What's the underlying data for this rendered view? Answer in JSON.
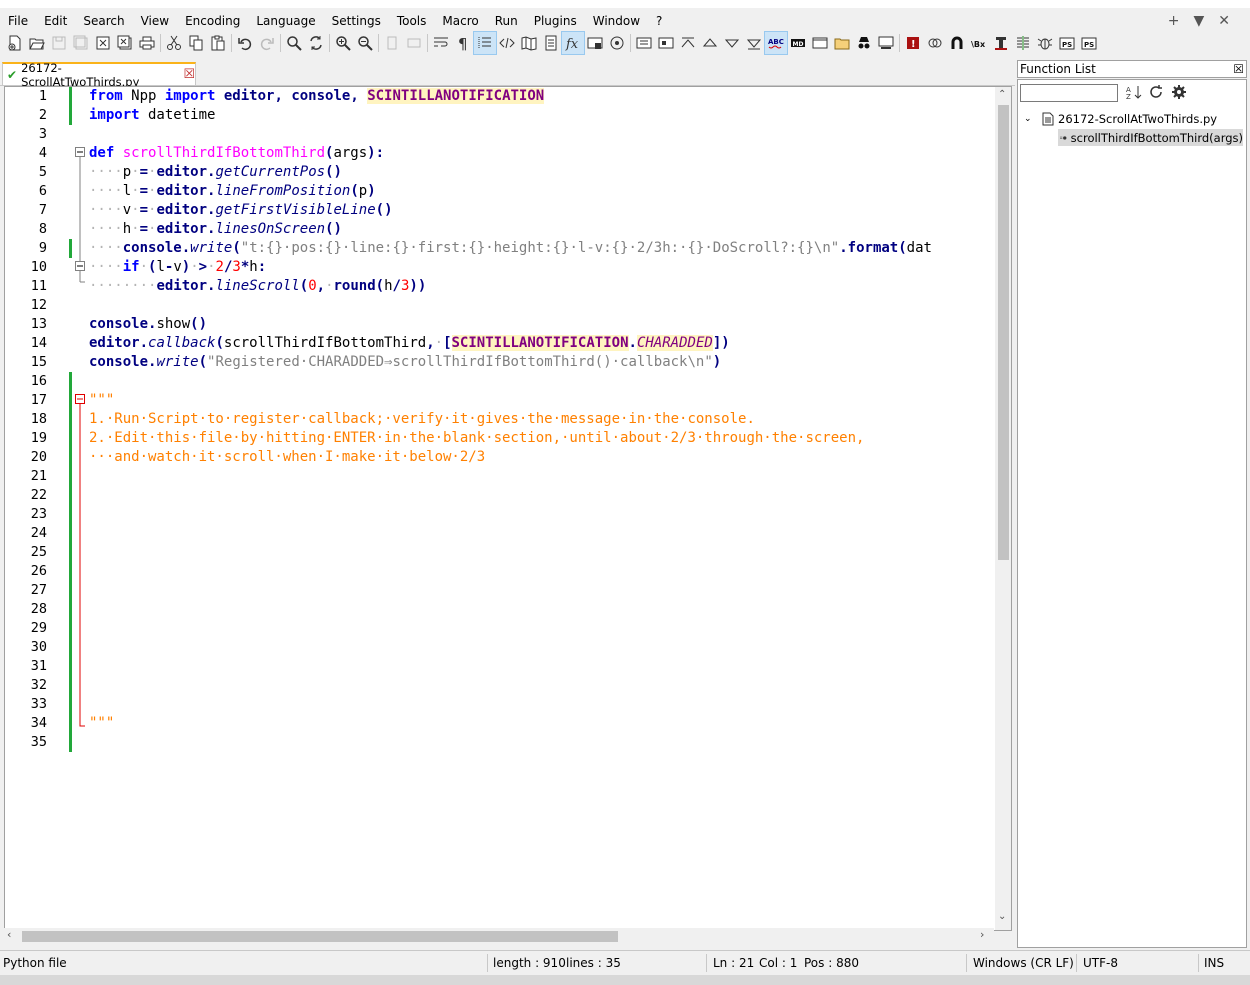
{
  "menubar": {
    "items": [
      "File",
      "Edit",
      "Search",
      "View",
      "Encoding",
      "Language",
      "Settings",
      "Tools",
      "Macro",
      "Run",
      "Plugins",
      "Window",
      "?"
    ],
    "right": [
      "+",
      "▼",
      "✕"
    ]
  },
  "tab": {
    "label": "26172-ScrollAtTwoThirds.py",
    "close": "☒",
    "check": "✔"
  },
  "editor": {
    "line_numbers": [
      "1",
      "2",
      "3",
      "4",
      "5",
      "6",
      "7",
      "8",
      "9",
      "10",
      "11",
      "12",
      "13",
      "14",
      "15",
      "16",
      "17",
      "18",
      "19",
      "20",
      "21",
      "22",
      "23",
      "24",
      "25",
      "26",
      "27",
      "28",
      "29",
      "30",
      "31",
      "32",
      "33",
      "34",
      "35"
    ],
    "code": [
      [
        {
          "t": "from",
          "c": "kw"
        },
        {
          "t": " Npp ",
          "c": ""
        },
        {
          "t": "import",
          "c": "kw"
        },
        {
          "t": " editor",
          "c": "cl2"
        },
        {
          "t": ", ",
          "c": "op"
        },
        {
          "t": "console",
          "c": "cl2"
        },
        {
          "t": ", ",
          "c": "op"
        },
        {
          "t": "SCINTILLANOTIFICATION",
          "c": "hl"
        }
      ],
      [
        {
          "t": "import",
          "c": "kw"
        },
        {
          "t": " datetime",
          "c": ""
        }
      ],
      [],
      [
        {
          "t": "def",
          "c": "kw"
        },
        {
          "t": " scrollThirdIfBottomThird",
          "c": "fn"
        },
        {
          "t": "(",
          "c": "op"
        },
        {
          "t": "args",
          "c": ""
        },
        {
          "t": "):",
          "c": "op"
        }
      ],
      [
        {
          "t": "····",
          "c": "ws"
        },
        {
          "t": "p",
          "c": ""
        },
        {
          "t": "·",
          "c": "ws"
        },
        {
          "t": "=",
          "c": "op"
        },
        {
          "t": "·",
          "c": "ws"
        },
        {
          "t": "editor",
          "c": "cl2"
        },
        {
          "t": ".",
          "c": "op"
        },
        {
          "t": "getCurrentPos",
          "c": "mth"
        },
        {
          "t": "()",
          "c": "op"
        }
      ],
      [
        {
          "t": "····",
          "c": "ws"
        },
        {
          "t": "l",
          "c": ""
        },
        {
          "t": "·",
          "c": "ws"
        },
        {
          "t": "=",
          "c": "op"
        },
        {
          "t": "·",
          "c": "ws"
        },
        {
          "t": "editor",
          "c": "cl2"
        },
        {
          "t": ".",
          "c": "op"
        },
        {
          "t": "lineFromPosition",
          "c": "mth"
        },
        {
          "t": "(",
          "c": "op"
        },
        {
          "t": "p",
          "c": ""
        },
        {
          "t": ")",
          "c": "op"
        }
      ],
      [
        {
          "t": "····",
          "c": "ws"
        },
        {
          "t": "v",
          "c": ""
        },
        {
          "t": "·",
          "c": "ws"
        },
        {
          "t": "=",
          "c": "op"
        },
        {
          "t": "·",
          "c": "ws"
        },
        {
          "t": "editor",
          "c": "cl2"
        },
        {
          "t": ".",
          "c": "op"
        },
        {
          "t": "getFirstVisibleLine",
          "c": "mth"
        },
        {
          "t": "()",
          "c": "op"
        }
      ],
      [
        {
          "t": "····",
          "c": "ws"
        },
        {
          "t": "h",
          "c": ""
        },
        {
          "t": "·",
          "c": "ws"
        },
        {
          "t": "=",
          "c": "op"
        },
        {
          "t": "·",
          "c": "ws"
        },
        {
          "t": "editor",
          "c": "cl2"
        },
        {
          "t": ".",
          "c": "op"
        },
        {
          "t": "linesOnScreen",
          "c": "mth"
        },
        {
          "t": "()",
          "c": "op"
        }
      ],
      [
        {
          "t": "····",
          "c": "ws"
        },
        {
          "t": "console",
          "c": "cl2"
        },
        {
          "t": ".",
          "c": "op"
        },
        {
          "t": "write",
          "c": "mth"
        },
        {
          "t": "(",
          "c": "op"
        },
        {
          "t": "\"t:{}·pos:{}·line:{}·first:{}·height:{}·l-v:{}·2/3h:·{}·DoScroll?:{}\\n\"",
          "c": "str"
        },
        {
          "t": ".",
          "c": "op"
        },
        {
          "t": "format",
          "c": "cl2"
        },
        {
          "t": "(",
          "c": "op"
        },
        {
          "t": "dat",
          "c": ""
        }
      ],
      [
        {
          "t": "····",
          "c": "ws"
        },
        {
          "t": "if",
          "c": "kw"
        },
        {
          "t": "·",
          "c": "ws"
        },
        {
          "t": "(",
          "c": "op"
        },
        {
          "t": "l",
          "c": ""
        },
        {
          "t": "-",
          "c": "op"
        },
        {
          "t": "v",
          "c": ""
        },
        {
          "t": ")",
          "c": "op"
        },
        {
          "t": "·",
          "c": "ws"
        },
        {
          "t": ">",
          "c": "op"
        },
        {
          "t": "·",
          "c": "ws"
        },
        {
          "t": "2",
          "c": "num"
        },
        {
          "t": "/",
          "c": "op"
        },
        {
          "t": "3",
          "c": "num"
        },
        {
          "t": "*",
          "c": "op"
        },
        {
          "t": "h",
          "c": ""
        },
        {
          "t": ":",
          "c": "op"
        }
      ],
      [
        {
          "t": "········",
          "c": "ws"
        },
        {
          "t": "editor",
          "c": "cl2"
        },
        {
          "t": ".",
          "c": "op"
        },
        {
          "t": "lineScroll",
          "c": "mth"
        },
        {
          "t": "(",
          "c": "op"
        },
        {
          "t": "0",
          "c": "num"
        },
        {
          "t": ",",
          "c": "op"
        },
        {
          "t": "·",
          "c": "ws"
        },
        {
          "t": "round",
          "c": "cl2"
        },
        {
          "t": "(",
          "c": "op"
        },
        {
          "t": "h",
          "c": ""
        },
        {
          "t": "/",
          "c": "op"
        },
        {
          "t": "3",
          "c": "num"
        },
        {
          "t": "))",
          "c": "op"
        }
      ],
      [],
      [
        {
          "t": "console",
          "c": "cl2"
        },
        {
          "t": ".",
          "c": "op"
        },
        {
          "t": "show",
          "c": ""
        },
        {
          "t": "()",
          "c": "op"
        }
      ],
      [
        {
          "t": "editor",
          "c": "cl2"
        },
        {
          "t": ".",
          "c": "op"
        },
        {
          "t": "callback",
          "c": "mth"
        },
        {
          "t": "(",
          "c": "op"
        },
        {
          "t": "scrollThirdIfBottomThird",
          "c": ""
        },
        {
          "t": ",",
          "c": "op"
        },
        {
          "t": "·",
          "c": "ws"
        },
        {
          "t": "[",
          "c": "op"
        },
        {
          "t": "SCINTILLANOTIFICATION",
          "c": "hl"
        },
        {
          "t": ".",
          "c": "op"
        },
        {
          "t": "CHARADDED",
          "c": "hli"
        },
        {
          "t": "])",
          "c": "op"
        }
      ],
      [
        {
          "t": "console",
          "c": "cl2"
        },
        {
          "t": ".",
          "c": "op"
        },
        {
          "t": "write",
          "c": "mth"
        },
        {
          "t": "(",
          "c": "op"
        },
        {
          "t": "\"Registered·CHARADDED⇒scrollThirdIfBottomThird()·callback\\n\"",
          "c": "str"
        },
        {
          "t": ")",
          "c": "op"
        }
      ],
      [],
      [
        {
          "t": "\"\"\"",
          "c": "cmt"
        }
      ],
      [
        {
          "t": "1.·Run·Script·to·register·callback;·verify·it·gives·the·message·in·the·console.",
          "c": "cmt"
        }
      ],
      [
        {
          "t": "2.·Edit·this·file·by·hitting·ENTER·in·the·blank·section,·until·about·2/3·through·the·screen,",
          "c": "cmt"
        }
      ],
      [
        {
          "t": "···and·watch·it·scroll·when·I·make·it·below·2/3",
          "c": "cmt"
        }
      ],
      [],
      [],
      [],
      [],
      [],
      [],
      [],
      [],
      [],
      [],
      [],
      [],
      [],
      [
        {
          "t": "\"\"\"",
          "c": "cmt"
        }
      ],
      []
    ]
  },
  "function_list": {
    "title": "Function List",
    "close": "☒",
    "search_value": "",
    "file": "26172-ScrollAtTwoThirds.py",
    "function": "scrollThirdIfBottomThird(args)"
  },
  "status": {
    "filetype": "Python file",
    "length": "length : 910",
    "lines": "lines : 35",
    "ln": "Ln : 21",
    "col": "Col : 1",
    "pos": "Pos : 880",
    "eol": "Windows (CR LF)",
    "encoding": "UTF-8",
    "mode": "INS"
  }
}
